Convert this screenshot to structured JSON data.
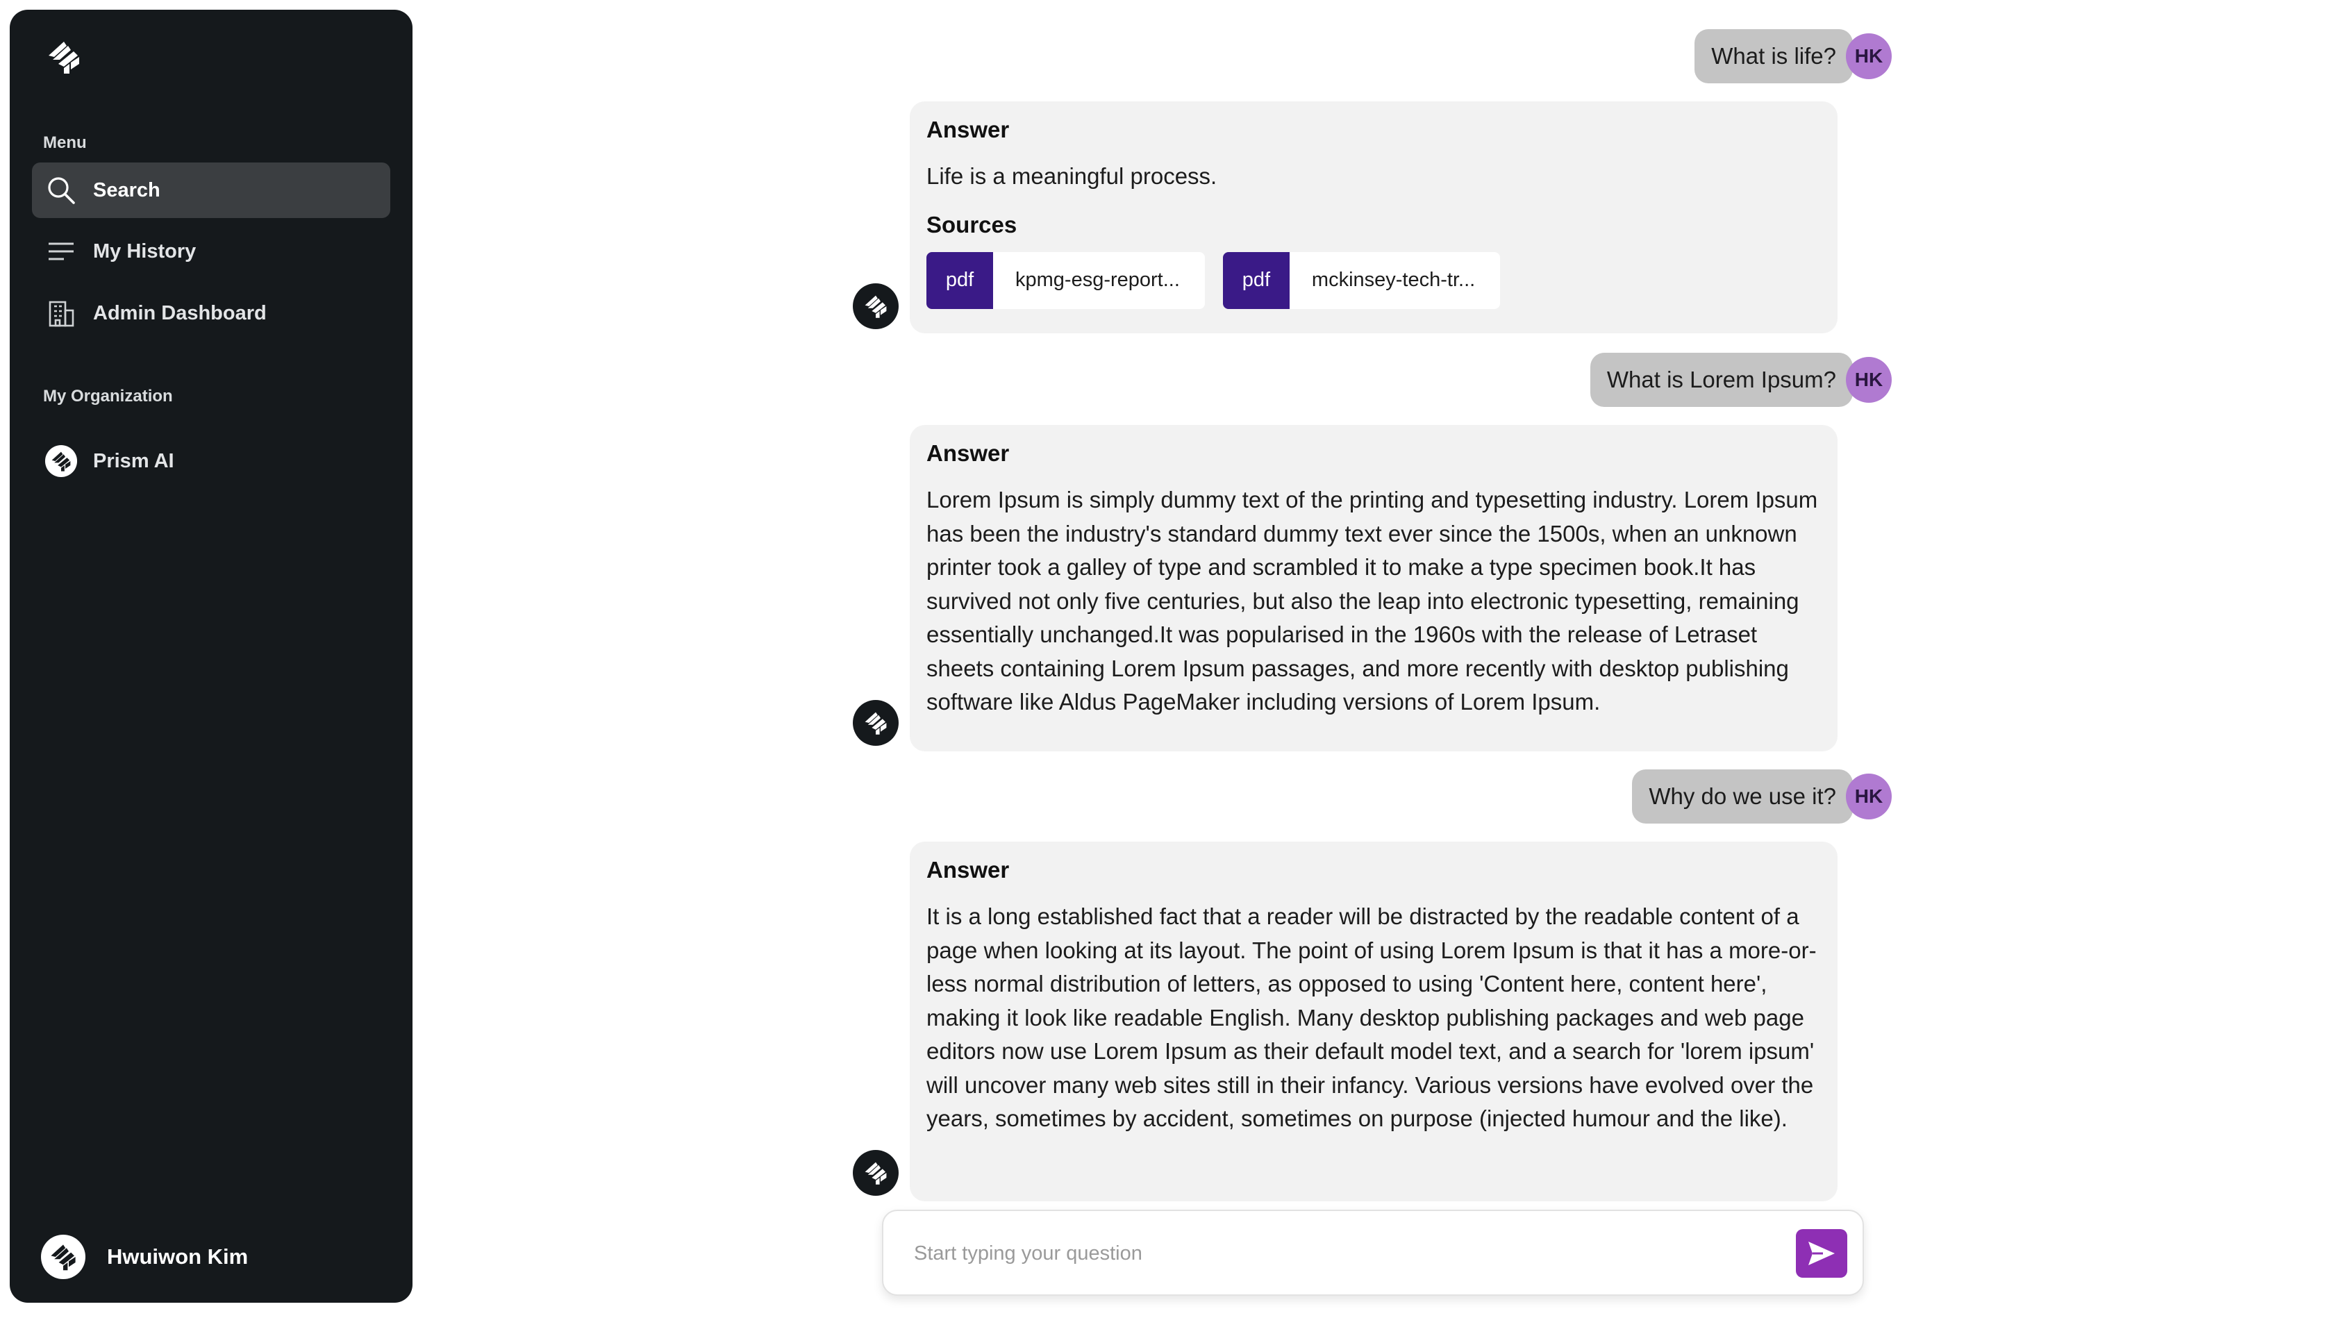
{
  "sidebar": {
    "menu_label": "Menu",
    "items": [
      {
        "label": "Search",
        "icon": "search-icon",
        "active": true
      },
      {
        "label": "My History",
        "icon": "history-icon",
        "active": false
      },
      {
        "label": "Admin Dashboard",
        "icon": "building-icon",
        "active": false
      }
    ],
    "org_label": "My Organization",
    "org": {
      "label": "Prism AI",
      "icon": "prism-logo-icon"
    },
    "user": {
      "name": "Hwuiwon Kim"
    }
  },
  "conversation": [
    {
      "question": "What is life?",
      "user_initials": "HK",
      "answer_title": "Answer",
      "answer": "Life is a meaningful process.",
      "sources_title": "Sources",
      "sources": [
        {
          "type": "pdf",
          "name": "kpmg-esg-report..."
        },
        {
          "type": "pdf",
          "name": "mckinsey-tech-tr..."
        }
      ]
    },
    {
      "question": "What is Lorem Ipsum?",
      "user_initials": "HK",
      "answer_title": "Answer",
      "answer": "Lorem Ipsum is simply dummy text of the printing and typesetting industry. Lorem Ipsum has been the industry's standard dummy text ever since the 1500s, when an unknown printer took a galley of type and scrambled it to make a type specimen book.It has survived not only five centuries, but also the leap into electronic typesetting, remaining essentially unchanged.It was popularised in the 1960s with the release of Letraset sheets containing Lorem Ipsum passages, and more recently with desktop publishing software like Aldus PageMaker including versions of Lorem Ipsum."
    },
    {
      "question": "Why do we use it?",
      "user_initials": "HK",
      "answer_title": "Answer",
      "answer": "It is a long established fact that a reader will be distracted by the readable content of a page when looking at its layout. The point of using Lorem Ipsum is that it has a more-or-less normal distribution of letters, as opposed to using 'Content here, content here', making it look like readable English. Many desktop publishing packages and web page editors now use Lorem Ipsum as their default model text, and a search for 'lorem ipsum' will uncover many web sites still in their infancy. Various versions have evolved over the years, sometimes by accident, sometimes on purpose (injected humour and the like)."
    }
  ],
  "input": {
    "placeholder": "Start typing your question",
    "value": ""
  },
  "colors": {
    "sidebar_bg": "#15191c",
    "active_item_bg": "#3b3e41",
    "user_bubble": "#c4c4c4",
    "user_avatar": "#b07ad1",
    "answer_card": "#f2f2f2",
    "pdf_tag": "#3a1a87",
    "send_button": "#8e2fb4"
  }
}
